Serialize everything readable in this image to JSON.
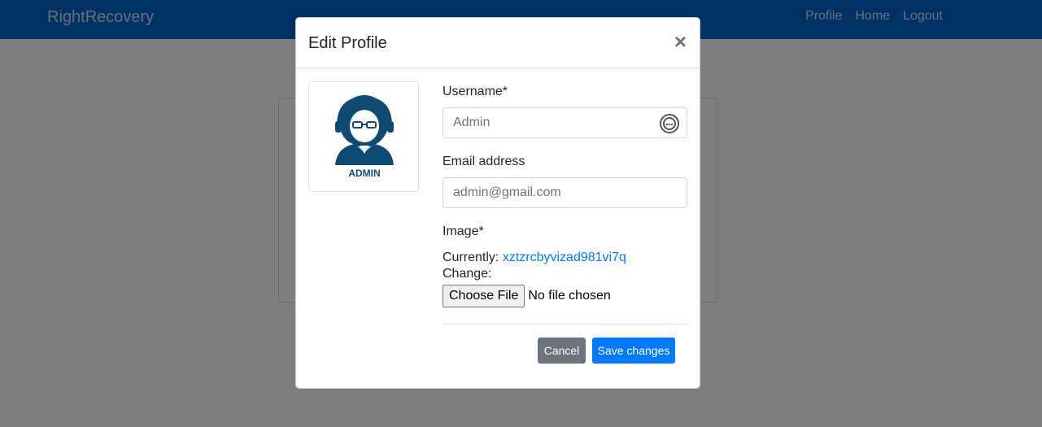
{
  "navbar": {
    "brand": "RightRecovery",
    "links": [
      "Profile",
      "Home",
      "Logout"
    ]
  },
  "modal": {
    "title": "Edit Profile",
    "close_symbol": "×",
    "avatar": {
      "caption": "ADMIN",
      "icon": "admin-avatar-icon"
    },
    "username": {
      "label": "Username*",
      "value": "Admin"
    },
    "email": {
      "label": "Email address",
      "value": "admin@gmail.com"
    },
    "image": {
      "label": "Image*",
      "currently_label": "Currently:",
      "currently_value": "xztzrcbyvizad981vi7q",
      "change_label": "Change:",
      "choose_button": "Choose File",
      "file_status": "No file chosen"
    },
    "buttons": {
      "cancel": "Cancel",
      "save": "Save changes"
    }
  },
  "colors": {
    "navbar": "#0062cc",
    "primary": "#007bff",
    "secondary": "#6c757d",
    "avatar": "#0e4a72"
  }
}
